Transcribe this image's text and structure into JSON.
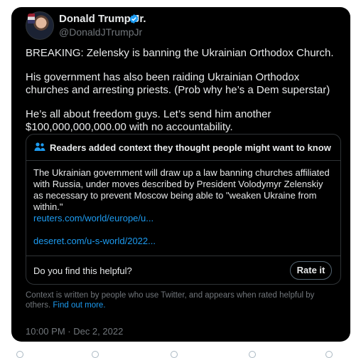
{
  "author": {
    "display_name": "Donald Trump Jr.",
    "handle": "@DonaldJTrumpJr"
  },
  "tweet": {
    "paragraphs": [
      "BREAKING: Zelensky is banning the Ukrainian Orthodox Church.",
      "His government has also been raiding Ukrainian Orthodox churches and arresting priests. (Prob why he’s a Dem superstar)",
      "He’s all about freedom guys. Let’s send him another $100,000,000,000.00 with no accountability."
    ],
    "timestamp": "10:00 PM · Dec 2, 2022"
  },
  "community_note": {
    "header": "Readers added context they thought people might want to know",
    "body": "The Ukrainian government will draw up a law banning churches affiliated with Russia, under moves described by President Volodymyr Zelenskiy as necessary to prevent Moscow being able to \"weaken Ukraine from within.\"",
    "links": [
      "reuters.com/world/europe/u...",
      "deseret.com/u-s-world/2022..."
    ],
    "helpful_question": "Do you find this helpful?",
    "rate_button": "Rate it"
  },
  "context_footer": {
    "text": "Context is written by people who use Twitter, and appears when rated helpful by others.",
    "link": "Find out more."
  },
  "colors": {
    "background": "#000000",
    "text": "#e7e9ea",
    "muted": "#71767b",
    "link": "#1d9bf0",
    "verified": "#1d9bf0"
  },
  "icons": [
    "verified-badge-icon",
    "people-icon"
  ]
}
